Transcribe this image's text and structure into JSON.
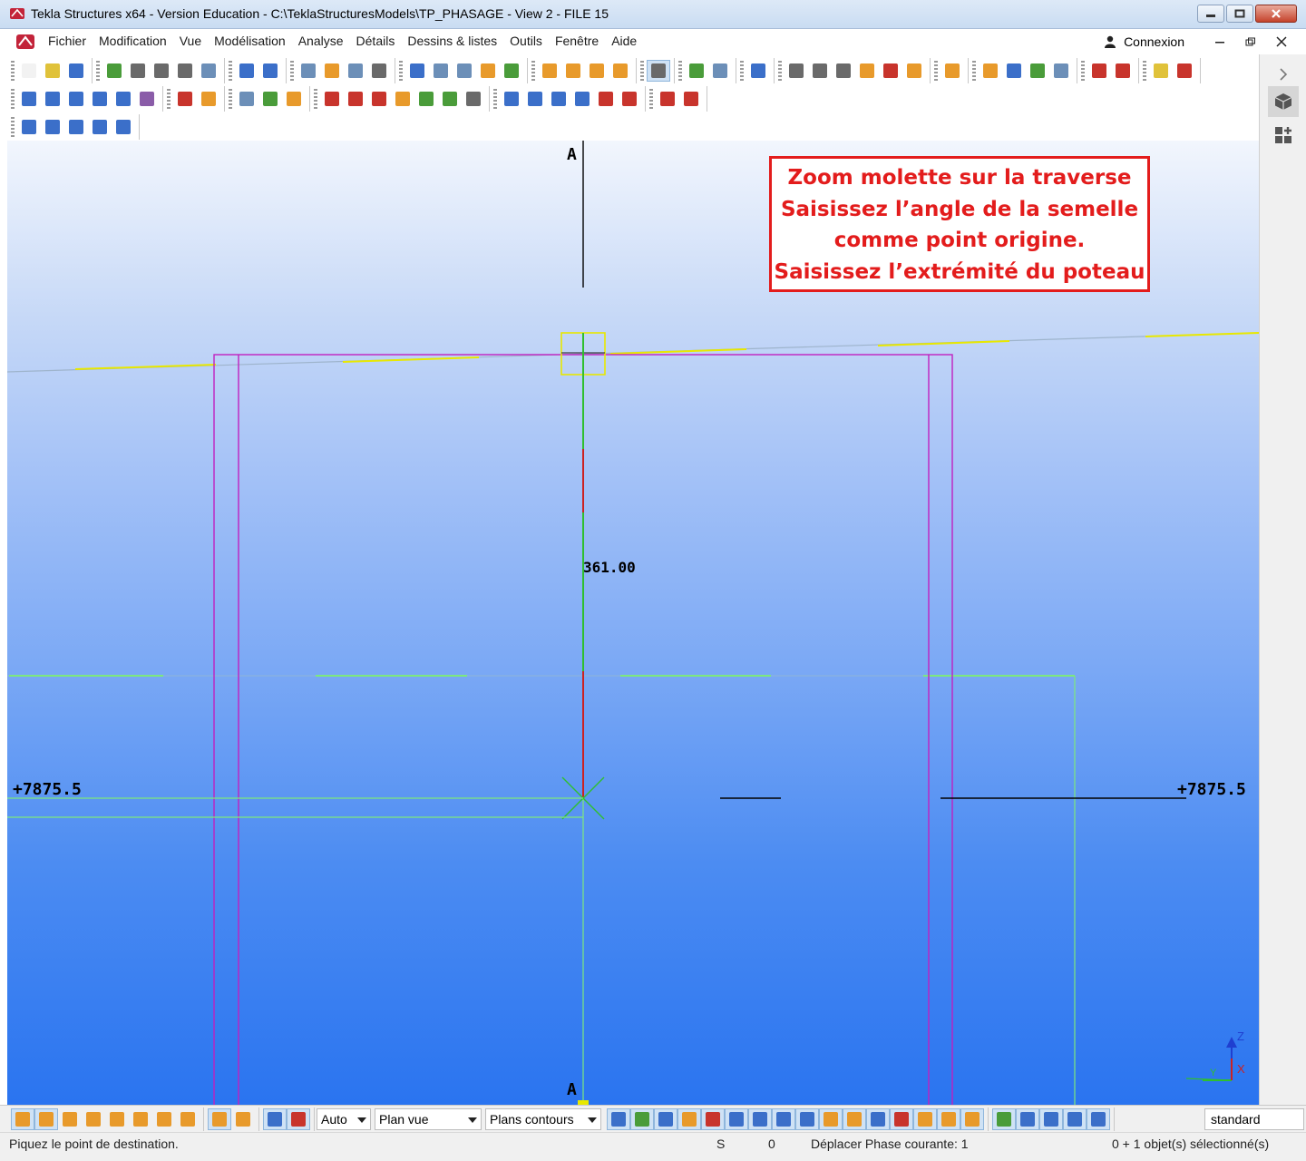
{
  "window": {
    "title": "Tekla Structures x64 - Version Education - C:\\TeklaStructuresModels\\TP_PHASAGE  - View 2 - FILE 15"
  },
  "menu": {
    "items": [
      "Fichier",
      "Modification",
      "Vue",
      "Modélisation",
      "Analyse",
      "Détails",
      "Dessins & listes",
      "Outils",
      "Fenêtre",
      "Aide"
    ],
    "login_label": "Connexion"
  },
  "viewport": {
    "callout_lines": [
      "Zoom molette sur la traverse",
      "Saisissez l’angle de la semelle",
      "comme point origine.",
      "Saisissez l’extrémité du poteau"
    ],
    "grid_label_top": "A",
    "grid_label_bottom": "A",
    "dimension_value": "361.00",
    "level_left": "+7875.5",
    "level_right": "+7875.5",
    "axes": {
      "z": "Z",
      "x": "X",
      "y": "Y"
    }
  },
  "bottom_toolbar": {
    "dropdown_auto": "Auto",
    "dropdown_plane": "Plan vue",
    "dropdown_contours": "Plans contours",
    "standard": "standard"
  },
  "status": {
    "prompt": "Piquez le point de destination.",
    "s_label": "S",
    "zero": "0",
    "phase": "Déplacer Phase courante: 1",
    "selection": "0 + 1 objet(s) sélectionné(s)"
  },
  "colors": {
    "callout": "#e31c1c",
    "magenta": "#c020c0",
    "grid_green": "#7de87d",
    "yellow": "#e8e800"
  }
}
